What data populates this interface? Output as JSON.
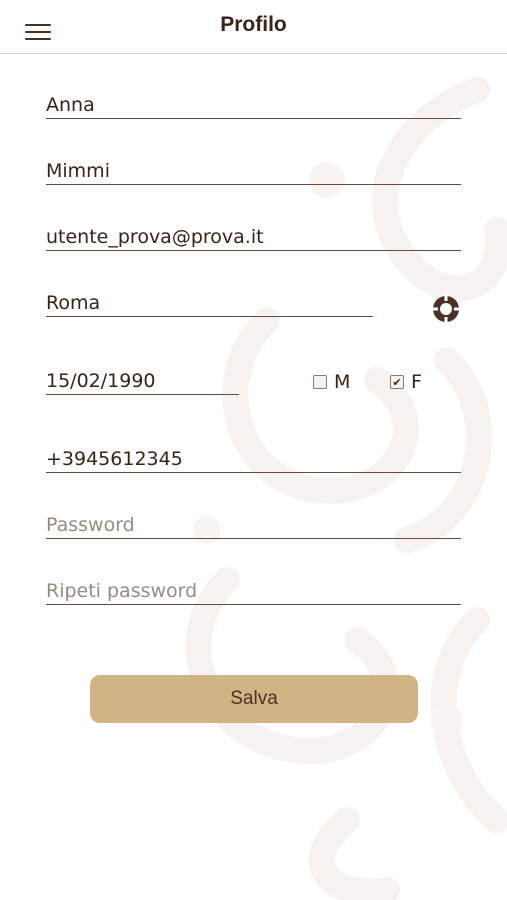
{
  "header": {
    "title": "Profilo",
    "menu_icon": "hamburger-menu-icon"
  },
  "form": {
    "first_name": "Anna",
    "last_name": "Mimmi",
    "email": "utente_prova@prova.it",
    "city": "Roma",
    "birth_date": "15/02/1990",
    "phone": "+3945612345",
    "password_placeholder": "Password",
    "repeat_password_placeholder": "Ripeti password",
    "gender_male_label": "M",
    "gender_female_label": "F",
    "gender_male_checked": false,
    "gender_female_checked": true,
    "locate_icon": "crosshair-locate-icon"
  },
  "actions": {
    "save_label": "Salva"
  },
  "colors": {
    "accent": "#d1b483",
    "text": "#3a2418",
    "underline": "#6a4a3a"
  }
}
